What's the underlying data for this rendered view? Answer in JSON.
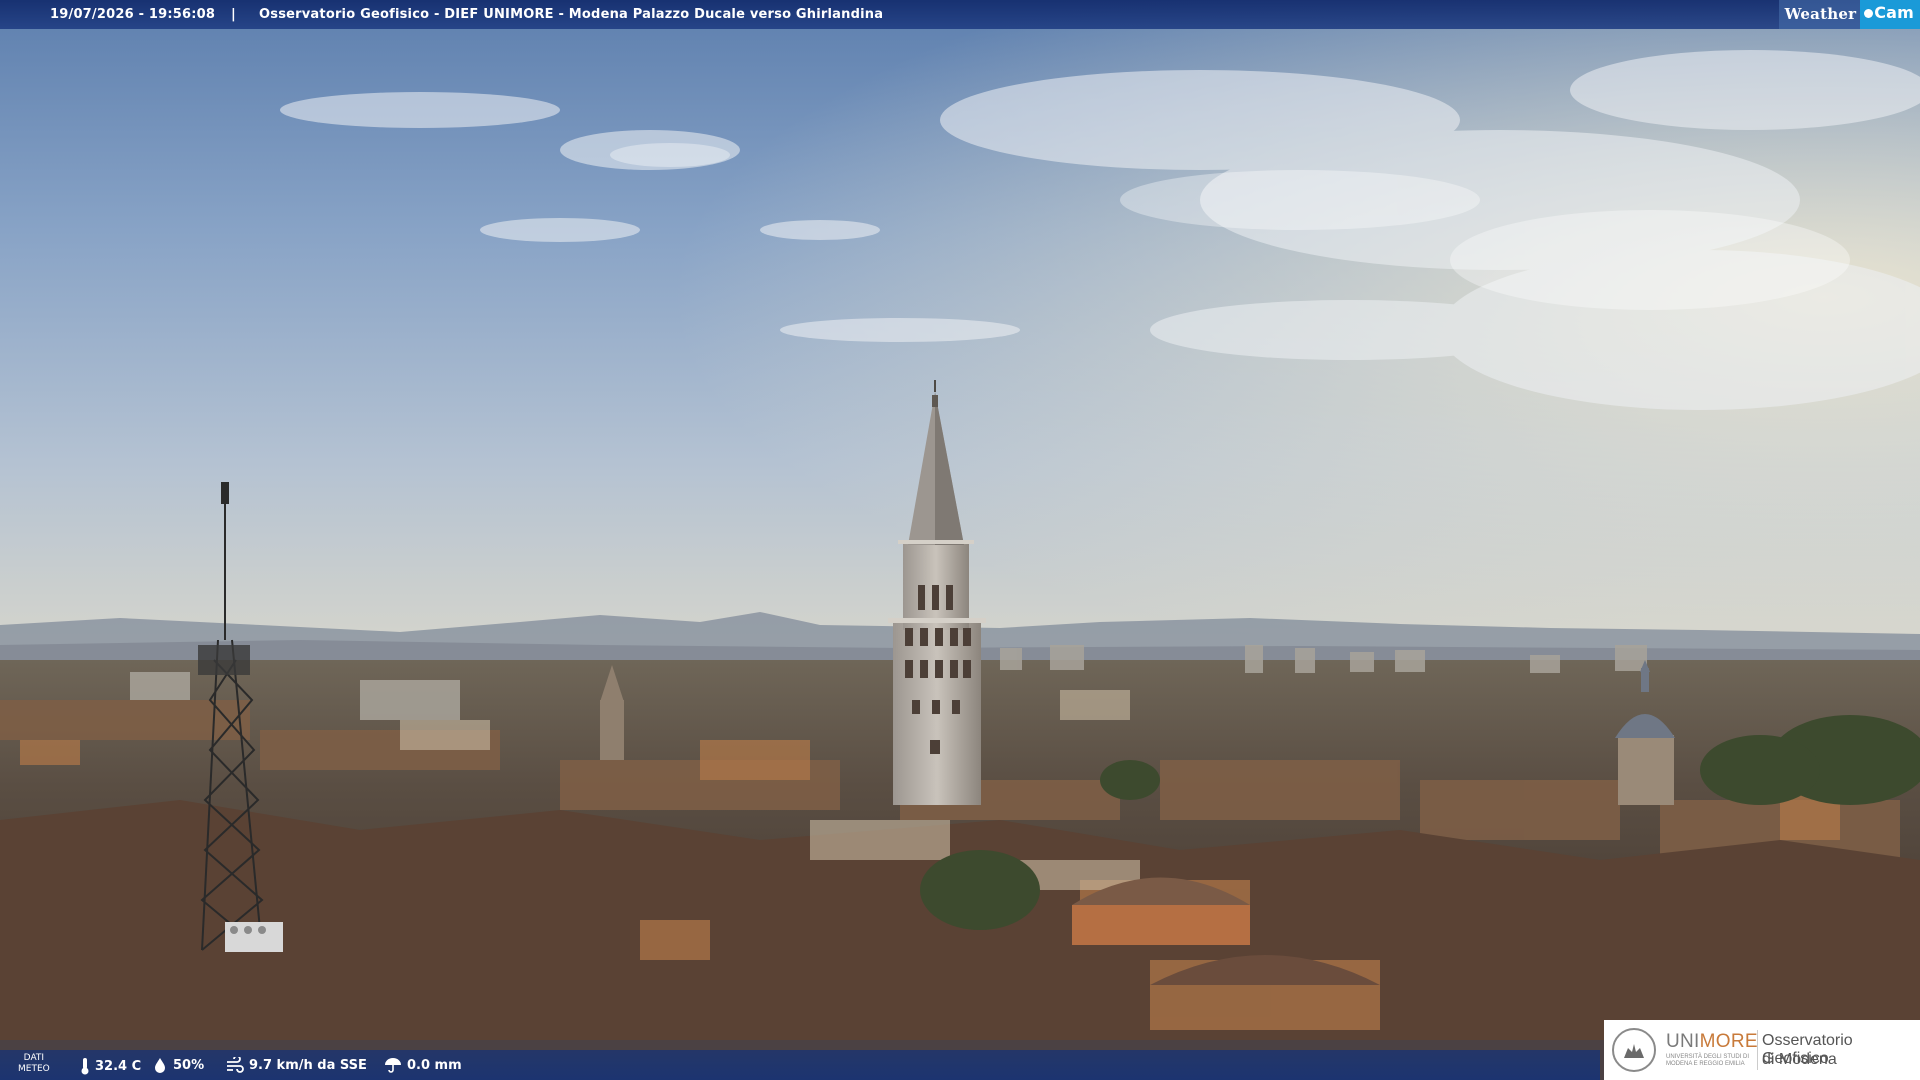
{
  "overlay": {
    "datetime": "19/07/2026 - 19:56:08",
    "separator": "|",
    "title": "Osservatorio Geofisico - DIEF UNIMORE - Modena Palazzo Ducale verso Ghirlandina",
    "brand_weather": "Weather",
    "brand_cam": "Cam"
  },
  "weather": {
    "dati_meteo_line1": "DATI",
    "dati_meteo_line2": "METEO",
    "temperature": "32.4 C",
    "humidity": "50%",
    "wind": "9.7 km/h da SSE",
    "rain": "0.0 mm"
  },
  "sponsor": {
    "name_part1": "UNI",
    "name_part2": "MORE",
    "subtitle": "UNIVERSITÀ DEGLI STUDI DI MODENA E REGGIO EMILIA",
    "observatory_line1": "Osservatorio Geofisico",
    "observatory_line2": "di Modena"
  },
  "colors": {
    "bar_blue": "#1e3c82",
    "cam_blue": "#1a9ad8",
    "unimore_orange": "#c87a3a"
  }
}
